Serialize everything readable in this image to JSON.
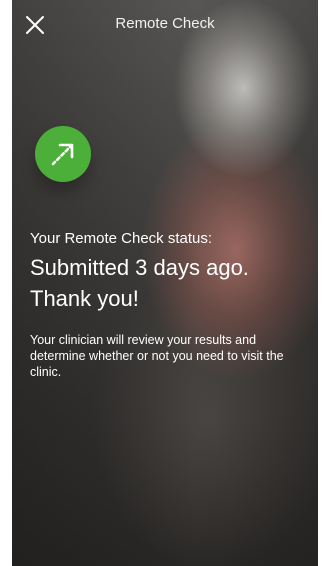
{
  "header": {
    "title": "Remote Check",
    "close_icon": "close-icon"
  },
  "status": {
    "icon": "arrow-up-right-icon",
    "icon_color": "#4caf3a",
    "label": "Your Remote Check status:",
    "headline_line1": "Submitted 3 days ago.",
    "headline_line2": "Thank you!",
    "message": "Your clinician will review your results and determine whether or not you need to visit the clinic."
  }
}
